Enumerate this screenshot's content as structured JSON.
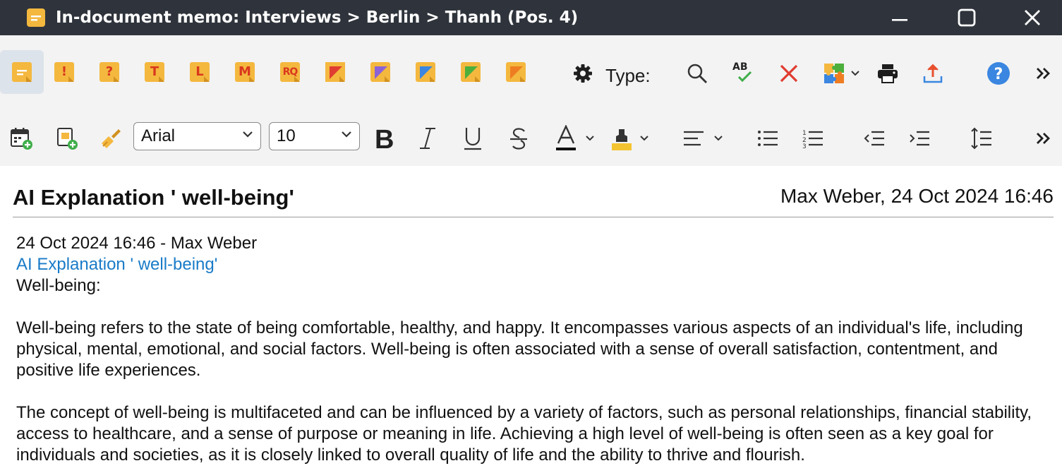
{
  "window": {
    "title": "In-document memo: Interviews > Berlin > Thanh (Pos. 4)"
  },
  "toolbar": {
    "type_label": "Type:",
    "font_family_value": "Arial",
    "font_size_value": "10",
    "memo_types": [
      {
        "icon": "memo-standard-icon",
        "glyph": ""
      },
      {
        "icon": "memo-important-icon",
        "glyph": "!"
      },
      {
        "icon": "memo-question-icon",
        "glyph": "?"
      },
      {
        "icon": "memo-theory-icon",
        "glyph": "T"
      },
      {
        "icon": "memo-literature-icon",
        "glyph": "L"
      },
      {
        "icon": "memo-method-icon",
        "glyph": "M"
      },
      {
        "icon": "memo-research-question-icon",
        "glyph": "RQ"
      },
      {
        "icon": "memo-red-corner-icon",
        "glyph": ""
      },
      {
        "icon": "memo-purple-corner-icon",
        "glyph": ""
      },
      {
        "icon": "memo-blue-corner-icon",
        "glyph": ""
      },
      {
        "icon": "memo-green-corner-icon",
        "glyph": ""
      },
      {
        "icon": "memo-orange-corner-icon",
        "glyph": ""
      }
    ]
  },
  "document": {
    "title": "AI Explanation ' well-being'",
    "meta": "Max Weber, 24 Oct 2024 16:46",
    "body": {
      "line_date_author": "24 Oct 2024 16:46 - Max Weber",
      "link_text": "AI Explanation ' well-being'",
      "heading_line": "Well-being:",
      "paragraph1": "Well-being refers to the state of being comfortable, healthy, and happy. It encompasses various aspects of an individual's life, including physical, mental, emotional, and social factors. Well-being is often associated with a sense of overall satisfaction, contentment, and positive life experiences.",
      "paragraph2": "The concept of well-being is multifaceted and can be influenced by a variety of factors, such as personal relationships, financial stability, access to healthcare, and a sense of purpose or meaning in life. Achieving a high level of well-being is often seen as a key goal for individuals and societies, as it is closely linked to overall quality of life and the ability to thrive and flourish."
    }
  },
  "colors": {
    "titlebar_bg": "#2f343c",
    "memo_yellow": "#f4b83f",
    "memo_red": "#d9381e",
    "link_blue": "#1a7bc8",
    "help_blue": "#3a86e0",
    "delete_red": "#e03c31"
  }
}
